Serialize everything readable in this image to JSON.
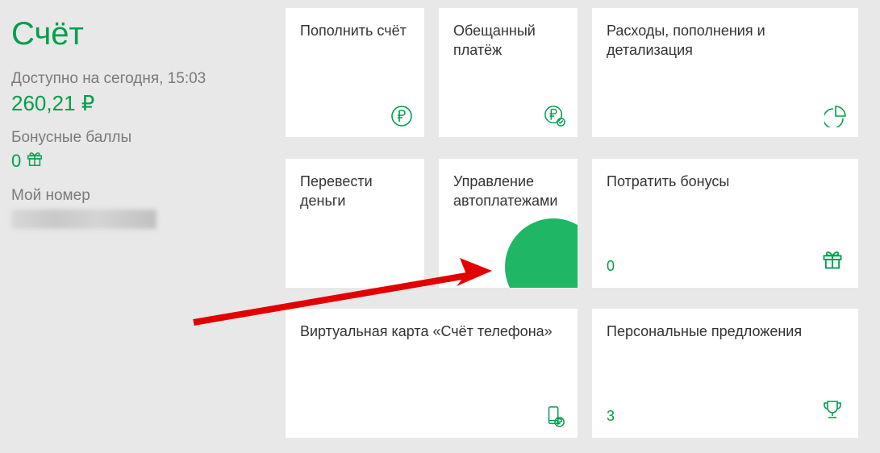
{
  "sidebar": {
    "title": "Счёт",
    "available_label": "Доступно на сегодня, 15:03",
    "balance": "260,21 ₽",
    "bonus_label": "Бонусные баллы",
    "bonus_value": "0",
    "my_number_label": "Мой номер"
  },
  "cards": {
    "topup": "Пополнить счёт",
    "promised": "Обещанный платёж",
    "expenses": "Расходы, пополнения и детализация",
    "transfer": "Перевести деньги",
    "autopay": "Управление автоплатежами",
    "spend_bonus": "Потратить бонусы",
    "spend_bonus_value": "0",
    "virtual_card": "Виртуальная карта «Счёт телефона»",
    "personal_offers": "Персональные предложения",
    "personal_offers_value": "3"
  }
}
